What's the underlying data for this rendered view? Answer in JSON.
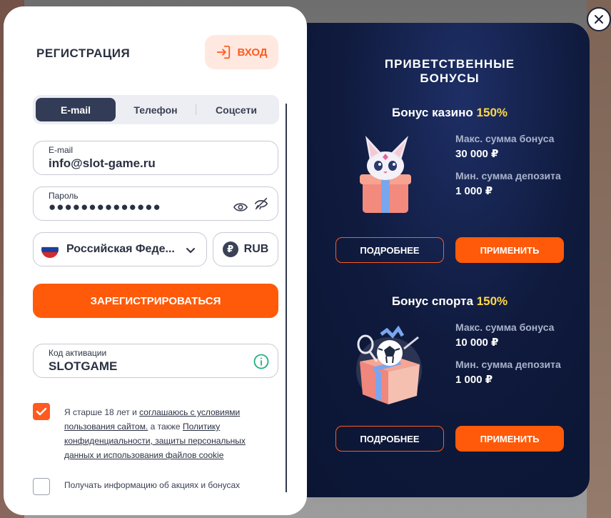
{
  "registration": {
    "title": "РЕГИСТРАЦИЯ",
    "login_label": "ВХОД",
    "tabs": [
      {
        "label": "E-mail",
        "active": true
      },
      {
        "label": "Телефон",
        "active": false
      },
      {
        "label": "Соцсети",
        "active": false
      }
    ],
    "email_field": {
      "label": "E-mail",
      "value": "info@slot-game.ru"
    },
    "password_field": {
      "label": "Пароль",
      "value": "●●●●●●●●●●●●●●"
    },
    "country": "Российская Феде...",
    "currency": "RUB",
    "currency_symbol": "₽",
    "register_label": "ЗАРЕГИСТРИРОВАТЬСЯ",
    "activation_field": {
      "label": "Код активации",
      "value": "SLOTGAME"
    },
    "consent": {
      "text_1": "Я старше 18 лет и ",
      "link_terms": "соглашаюсь с условиями пользования сайтом.",
      "text_2": " а также ",
      "link_policy": "Политику конфиденциальности, защиты персональных данных и использования файлов cookie",
      "checked": true
    },
    "promo_opt_in": {
      "label": "Получать информацию об акциях и бонусах",
      "checked": false
    }
  },
  "bonuses": {
    "title": "ПРИВЕТСТВЕННЫЕ БОНУСЫ",
    "items": [
      {
        "name": "Бонус казино",
        "percent": "150%",
        "max_label": "Макс. сумма бонуса",
        "max_value": "30 000 ₽",
        "min_label": "Мин. сумма депозита",
        "min_value": "1 000 ₽",
        "details_label": "ПОДРОБНЕЕ",
        "apply_label": "ПРИМЕНИТЬ",
        "art_icon": "fox-gift-icon"
      },
      {
        "name": "Бонус спорта",
        "percent": "150%",
        "max_label": "Макс. сумма бонуса",
        "max_value": "10 000 ₽",
        "min_label": "Мин. сумма депозита",
        "min_value": "1 000 ₽",
        "details_label": "ПОДРОБНЕЕ",
        "apply_label": "ПРИМЕНИТЬ",
        "art_icon": "sports-gift-icon"
      }
    ]
  },
  "colors": {
    "accent": "#ff5a09",
    "highlight": "#ffd84a",
    "panel_dark": "#0f1a3d",
    "tab_active": "#333c56"
  }
}
